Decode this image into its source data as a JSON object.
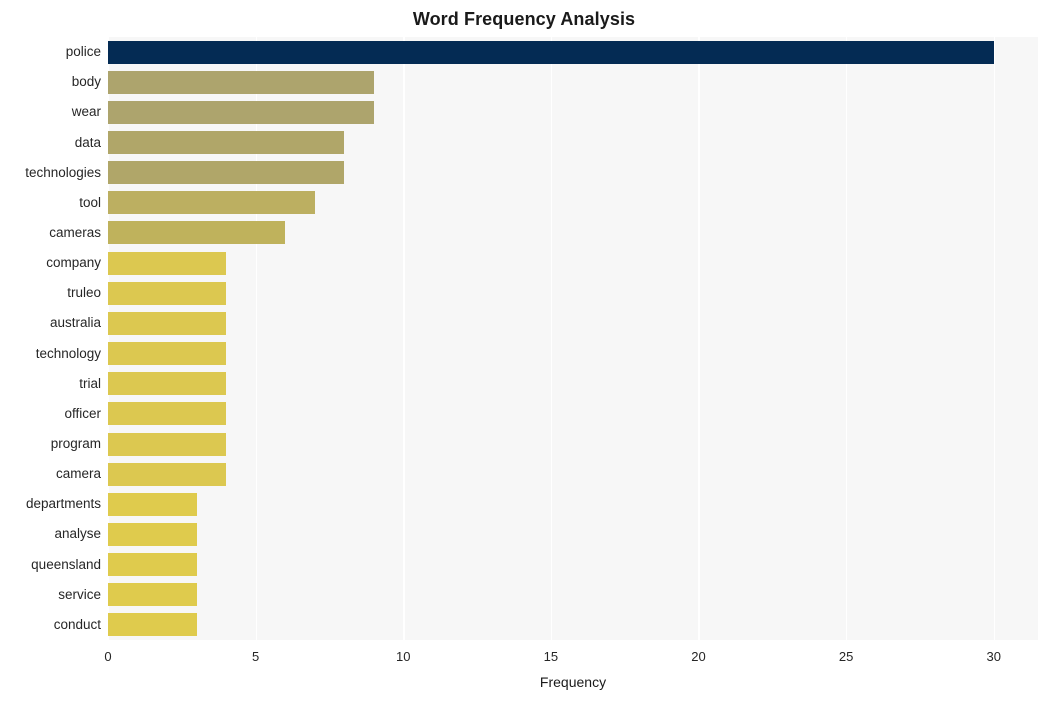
{
  "chart_data": {
    "type": "bar",
    "orientation": "horizontal",
    "title": "Word Frequency Analysis",
    "xlabel": "Frequency",
    "ylabel": "",
    "categories": [
      "police",
      "body",
      "wear",
      "data",
      "technologies",
      "tool",
      "cameras",
      "company",
      "truleo",
      "australia",
      "technology",
      "trial",
      "officer",
      "program",
      "camera",
      "departments",
      "analyse",
      "queensland",
      "service",
      "conduct"
    ],
    "values": [
      30,
      9,
      9,
      8,
      8,
      7,
      6,
      4,
      4,
      4,
      4,
      4,
      4,
      4,
      4,
      3,
      3,
      3,
      3,
      3
    ],
    "bar_colors": [
      "#042B54",
      "#ADA46D",
      "#ADA46D",
      "#B0A669",
      "#B0A669",
      "#BCAF61",
      "#BFB25C",
      "#DCC850",
      "#DCC850",
      "#DCC850",
      "#DCC850",
      "#DCC850",
      "#DCC850",
      "#DCC850",
      "#DCC850",
      "#DFCB4D",
      "#DFCB4D",
      "#DFCB4D",
      "#DFCB4D",
      "#DFCB4D"
    ],
    "xlim": [
      0,
      31.5
    ],
    "xticks": [
      0,
      5,
      10,
      15,
      20,
      25,
      30
    ],
    "xtick_labels": [
      "0",
      "5",
      "10",
      "15",
      "20",
      "25",
      "30"
    ],
    "grid": true,
    "grid_axis": "x",
    "grid_color": "#FFFFFF",
    "plot_background": "#F7F7F7",
    "figure_background": "#FFFFFF",
    "legend": null
  }
}
